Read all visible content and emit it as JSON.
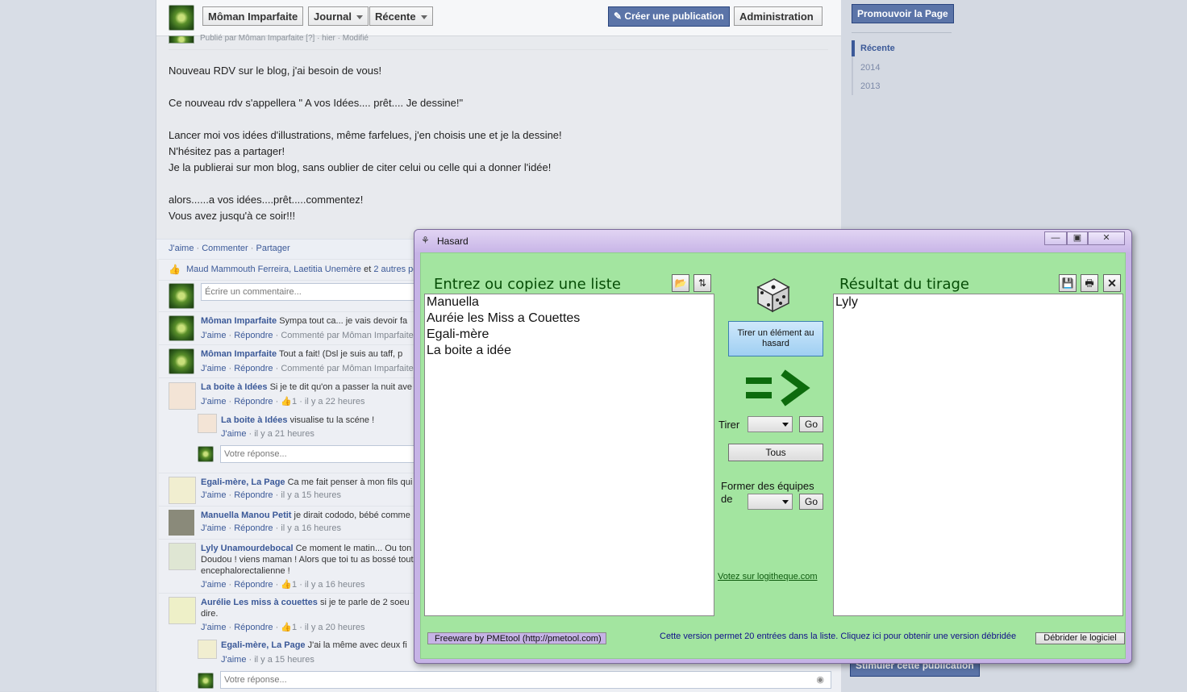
{
  "fb": {
    "header": {
      "page_name": "Môman Imparfaite",
      "journal": "Journal",
      "recent": "Récente",
      "create_post": "Créer une publication",
      "admin": "Administration"
    },
    "post": {
      "meta": "Publié par Môman Imparfaite [?] · hier · Modifié",
      "lines": [
        "Nouveau RDV sur le blog, j'ai besoin de vous!",
        "Ce nouveau rdv s'appellera \" A vos Idées.... prêt.... Je dessine!\"",
        "Lancer moi vos idées d'illustrations, même farfelues, j'en choisis une et je la dessine!",
        "N'hésitez pas a partager!",
        "Je la publierai sur mon blog, sans oublier de citer celui ou celle qui a donner l'idée!",
        "alors......a vos idées....prêt.....commentez!",
        "Vous avez jusqu'à ce soir!!!"
      ],
      "actions": [
        "J'aime",
        "Commenter",
        "Partager"
      ],
      "likes": {
        "names": "Maud Mammouth Ferreira, Laetitia Unemère",
        "rest": " et ",
        "others": "2 autres pe"
      },
      "comment_placeholder": "Écrire un commentaire..."
    },
    "comments": [
      {
        "name": "Môman Imparfaite",
        "text": " Sympa tout ca... je vais devoir fa",
        "meta_a": "J'aime",
        "meta_b": "Répondre",
        "meta_c": "· Commenté par Môman Imparfaite [?"
      },
      {
        "name": "Môman Imparfaite",
        "text": " Tout a fait! (Dsl je suis au taff, p",
        "meta_a": "J'aime",
        "meta_b": "Répondre",
        "meta_c": "· Commenté par Môman Imparfaite [?"
      },
      {
        "name": "La boite à Idées",
        "text": " Si je te dit qu'on a passer la nuit ave",
        "meta_a": "J'aime",
        "meta_b": "Répondre",
        "meta_c": "· 👍1 · il y a 22 heures"
      },
      {
        "name": "La boite à Idées",
        "text": " visualise tu la scéne !",
        "meta_a": "J'aime",
        "meta_b": "",
        "meta_c": "· il y a 21 heures"
      },
      {
        "name": "Egali-mère, La Page",
        "text": " Ca me fait penser à mon fils qui",
        "meta_a": "J'aime",
        "meta_b": "Répondre",
        "meta_c": "· il y a 15 heures"
      },
      {
        "name": "Manuella Manou Petit",
        "text": " je dirait cododo, bébé comme",
        "meta_a": "J'aime",
        "meta_b": "Répondre",
        "meta_c": "· il y a 16 heures"
      },
      {
        "name": "Lyly Unamourdebocal",
        "text": " Ce moment le matin... Ou ton",
        "line2": "Doudou ! viens maman ! Alors que toi tu as bossé toute",
        "line3": "encephalorectalienne !",
        "meta_a": "J'aime",
        "meta_b": "Répondre",
        "meta_c": "· 👍1 · il y a 16 heures"
      },
      {
        "name": "Aurélie Les miss à couettes",
        "text": " si je te parle de 2 soeu",
        "line2": "dire.",
        "meta_a": "J'aime",
        "meta_b": "Répondre",
        "meta_c": "· 👍1 · il y a 20 heures"
      },
      {
        "name": "Egali-mère, La Page",
        "text": " J'ai la même avec deux fi",
        "meta_a": "J'aime",
        "meta_b": "",
        "meta_c": "· il y a 15 heures"
      }
    ],
    "reply_placeholder": "Votre réponse...",
    "right": {
      "promote": "Promouvoir la Page",
      "timeline": [
        "Récente",
        "2014",
        "2013"
      ],
      "boost": "Stimuler cette publication"
    }
  },
  "hasard": {
    "title": "Hasard",
    "list_heading": "Entrez ou copiez une liste",
    "result_heading": "Résultat du tirage",
    "list_items": [
      "Manuella",
      "Auréie les Miss a Couettes",
      "Egali-mère",
      "La boite a idée"
    ],
    "result_items": [
      "Lyly"
    ],
    "draw_button": "Tirer un élément au hasard",
    "tirer_label": "Tirer",
    "go": "Go",
    "all_button": "Tous",
    "teams_label_1": "Former des équipes",
    "teams_label_2": "de",
    "vote_link": "Votez sur logitheque.com",
    "freeware": "Freeware by PMEtool (http://pmetool.com)",
    "version_note": "Cette version permet 20 entrées dans la liste. Cliquez ici pour obtenir une version débridée",
    "unlock_button": "Débrider le logiciel"
  },
  "colors": {
    "fb_blue": "#3b5998",
    "window_green": "#a3e5a0",
    "heading_green": "#064d06"
  }
}
